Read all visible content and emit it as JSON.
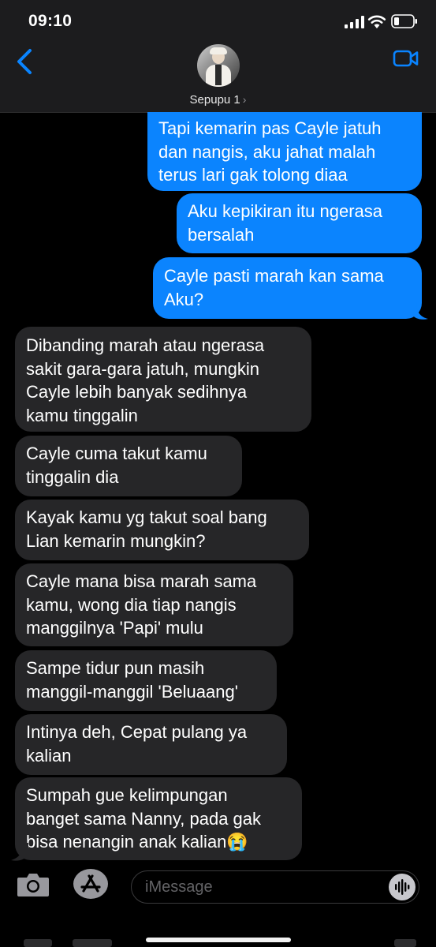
{
  "status": {
    "time": "09:10"
  },
  "header": {
    "contact_name": "Sepupu 1",
    "chevron": "›"
  },
  "messages": [
    {
      "from": "me",
      "text": "Tapi kemarin pas Cayle jatuh\ndan nangis, aku jahat malah\nterus lari gak tolong diaa"
    },
    {
      "from": "me",
      "text": "Aku kepikiran itu ngerasa\nbersalah"
    },
    {
      "from": "me",
      "text": "Cayle pasti marah kan sama\nAku?"
    },
    {
      "from": "them",
      "text": "Dibanding marah atau ngerasa\nsakit gara-gara jatuh,  mungkin\nCayle lebih banyak sedihnya\nkamu tinggalin"
    },
    {
      "from": "them",
      "text": "Cayle cuma takut kamu\ntinggalin dia"
    },
    {
      "from": "them",
      "text": "Kayak kamu yg takut soal bang\nLian kemarin mungkin?"
    },
    {
      "from": "them",
      "text": "Cayle mana bisa marah sama\nkamu, wong dia tiap nangis\nmanggilnya 'Papi' mulu"
    },
    {
      "from": "them",
      "text": "Sampe tidur pun masih\nmanggil-manggil 'Beluaang'"
    },
    {
      "from": "them",
      "text": "Intinya deh, Cepat pulang ya\nkalian"
    },
    {
      "from": "them",
      "text": "Sumpah gue kelimpungan\nbanget sama Nanny, pada gak\nbisa nenangin anak kalian😭"
    }
  ],
  "input": {
    "placeholder": "iMessage"
  },
  "icons": {
    "back": "chevron-left-icon",
    "video": "video-camera-icon",
    "camera": "camera-icon",
    "appstore": "app-store-icon",
    "audio": "audio-waveform-icon"
  },
  "colors": {
    "sent_bubble": "#0b84fe",
    "received_bubble": "#262628",
    "accent": "#0a84ff",
    "background": "#000000"
  }
}
